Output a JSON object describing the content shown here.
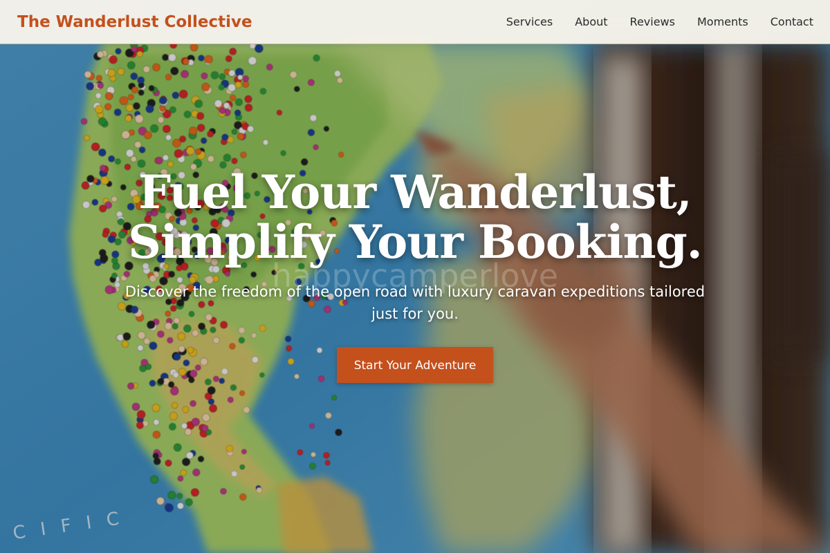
{
  "header": {
    "brand": "The Wanderlust Collective",
    "nav": [
      {
        "label": "Services"
      },
      {
        "label": "About"
      },
      {
        "label": "Reviews"
      },
      {
        "label": "Moments"
      },
      {
        "label": "Contact"
      }
    ]
  },
  "hero": {
    "title_line1": "Fuel Your Wanderlust,",
    "title_line2": "Simplify Your Booking.",
    "watermark": "happycamperlove",
    "subtitle": "Discover the freedom of the open road with luxury caravan expeditions tailored just for you.",
    "cta_label": "Start Your Adventure",
    "background_icon": "world-map-with-pins-image"
  },
  "colors": {
    "accent": "#c4501c",
    "header_bg": "#faf6ec",
    "nav_text": "#2a2a2a",
    "hero_text": "#ffffff"
  }
}
